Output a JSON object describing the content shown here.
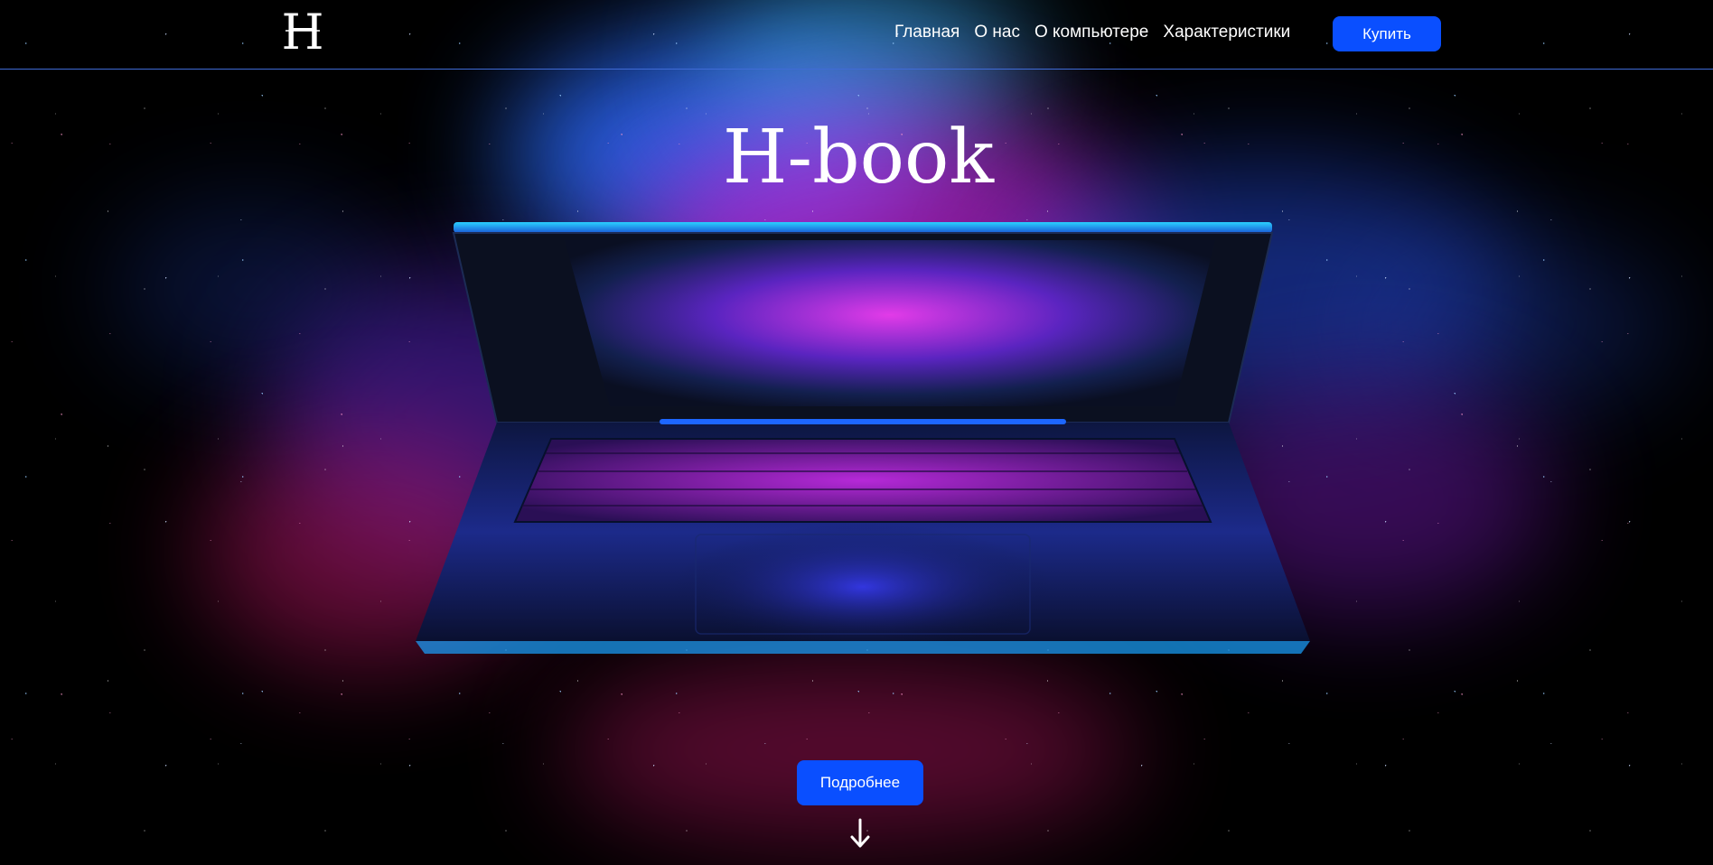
{
  "brand": {
    "logo_letter": "H",
    "hero_title": "H-book"
  },
  "nav": {
    "items": [
      {
        "label": "Главная"
      },
      {
        "label": "О нас"
      },
      {
        "label": "О компьютере"
      },
      {
        "label": "Характеристики"
      }
    ]
  },
  "header": {
    "buy_label": "Купить"
  },
  "hero": {
    "more_label": "Подробнее",
    "arrow_icon": "arrow-down-icon"
  },
  "colors": {
    "accent": "#0a4fff",
    "header_border": "#3f6bd6",
    "background": "#000000"
  }
}
